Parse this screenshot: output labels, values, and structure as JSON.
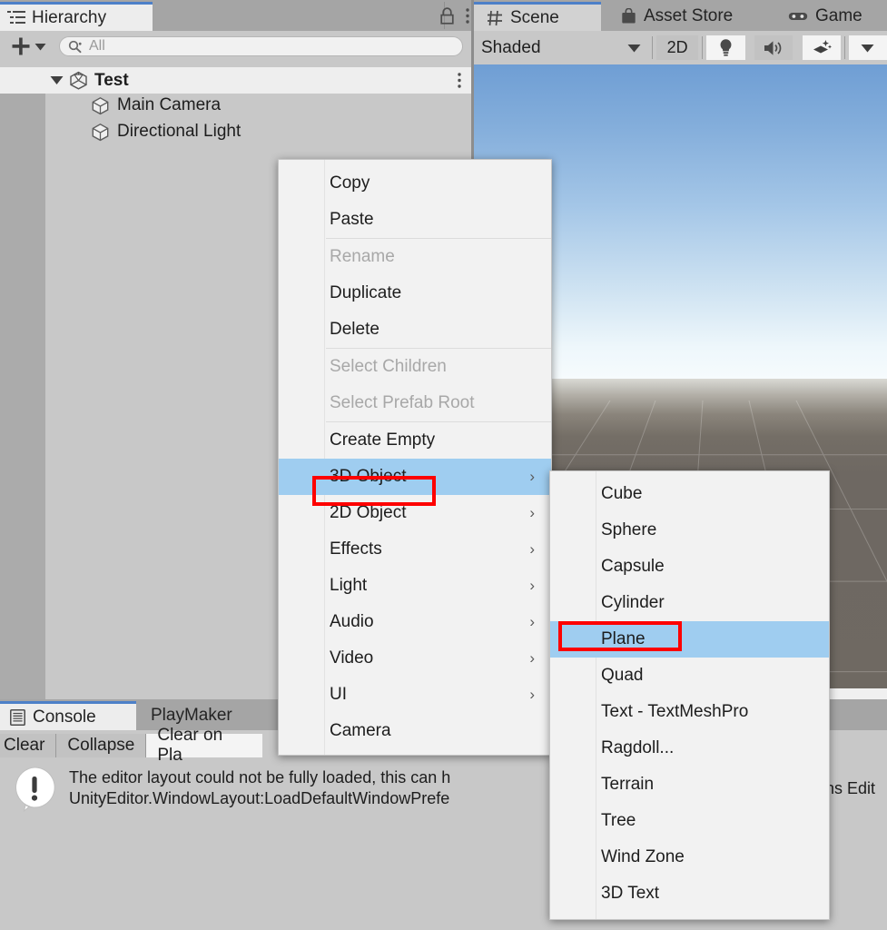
{
  "hierarchy": {
    "tab_label": "Hierarchy",
    "lock_icon": "lock-icon",
    "kebab_icon": "kebab-menu-icon",
    "add_label": "+",
    "search_placeholder": "All",
    "root": {
      "label": "Test",
      "icon": "unity-scene-icon"
    },
    "items": [
      {
        "label": "Main Camera",
        "icon": "gameobject-cube-icon"
      },
      {
        "label": "Directional Light",
        "icon": "gameobject-cube-icon"
      }
    ]
  },
  "scene": {
    "tabs": [
      {
        "label": "Scene",
        "icon": "grid-icon",
        "active": true
      },
      {
        "label": "Asset Store",
        "icon": "shop-bag-icon",
        "active": false
      },
      {
        "label": "Game",
        "icon": "gamepad-icon",
        "active": false
      }
    ],
    "toolbar": {
      "draw_mode": "Shaded",
      "two_d_label": "2D",
      "lighting_icon": "lightbulb-icon",
      "audio_icon": "speaker-icon",
      "fx_icon": "effects-layers-icon",
      "fx_dropdown_icon": "chevron-down-icon",
      "dropdown_icon": "chevron-down-icon"
    }
  },
  "console": {
    "tabs": [
      {
        "label": "Console",
        "icon": "console-icon",
        "active": true
      },
      {
        "label": "PlayMaker",
        "icon": "",
        "active": false
      }
    ],
    "toolbar": [
      {
        "label": "Clear",
        "style": "normal"
      },
      {
        "label": "Collapse",
        "style": "normal"
      },
      {
        "label": "Clear on Pla",
        "style": "light"
      }
    ],
    "log": {
      "icon": "error-bubble-icon",
      "line1": "The editor layout could not be fully loaded, this can h",
      "line2": "UnityEditor.WindowLayout:LoadDefaultWindowPrefe",
      "right_fragment": "ns Edit"
    }
  },
  "context_menu": {
    "items": [
      {
        "label": "Copy",
        "disabled": false,
        "submenu": false,
        "highlight": false
      },
      {
        "label": "Paste",
        "disabled": false,
        "submenu": false,
        "highlight": false
      },
      {
        "separator": true
      },
      {
        "label": "Rename",
        "disabled": true,
        "submenu": false,
        "highlight": false
      },
      {
        "label": "Duplicate",
        "disabled": false,
        "submenu": false,
        "highlight": false
      },
      {
        "label": "Delete",
        "disabled": false,
        "submenu": false,
        "highlight": false
      },
      {
        "separator": true
      },
      {
        "label": "Select Children",
        "disabled": true,
        "submenu": false,
        "highlight": false
      },
      {
        "label": "Select Prefab Root",
        "disabled": true,
        "submenu": false,
        "highlight": false
      },
      {
        "separator": true
      },
      {
        "label": "Create Empty",
        "disabled": false,
        "submenu": false,
        "highlight": false
      },
      {
        "label": "3D Object",
        "disabled": false,
        "submenu": true,
        "highlight": true
      },
      {
        "label": "2D Object",
        "disabled": false,
        "submenu": true,
        "highlight": false
      },
      {
        "label": "Effects",
        "disabled": false,
        "submenu": true,
        "highlight": false
      },
      {
        "label": "Light",
        "disabled": false,
        "submenu": true,
        "highlight": false
      },
      {
        "label": "Audio",
        "disabled": false,
        "submenu": true,
        "highlight": false
      },
      {
        "label": "Video",
        "disabled": false,
        "submenu": true,
        "highlight": false
      },
      {
        "label": "UI",
        "disabled": false,
        "submenu": true,
        "highlight": false
      },
      {
        "label": "Camera",
        "disabled": false,
        "submenu": false,
        "highlight": false
      }
    ]
  },
  "submenu": {
    "items": [
      {
        "label": "Cube",
        "highlight": false
      },
      {
        "label": "Sphere",
        "highlight": false
      },
      {
        "label": "Capsule",
        "highlight": false
      },
      {
        "label": "Cylinder",
        "highlight": false
      },
      {
        "label": "Plane",
        "highlight": true
      },
      {
        "label": "Quad",
        "highlight": false
      },
      {
        "label": "Text - TextMeshPro",
        "highlight": false
      },
      {
        "label": "Ragdoll...",
        "highlight": false
      },
      {
        "label": "Terrain",
        "highlight": false
      },
      {
        "label": "Tree",
        "highlight": false
      },
      {
        "label": "Wind Zone",
        "highlight": false
      },
      {
        "label": "3D Text",
        "highlight": false
      }
    ]
  },
  "colors": {
    "accent_tab": "#4d80c8",
    "menu_highlight": "#9fcdf0",
    "annotation_red": "#fe0000",
    "panel_bg": "#c8c8c8",
    "tabbar_bg": "#a5a5a5"
  }
}
